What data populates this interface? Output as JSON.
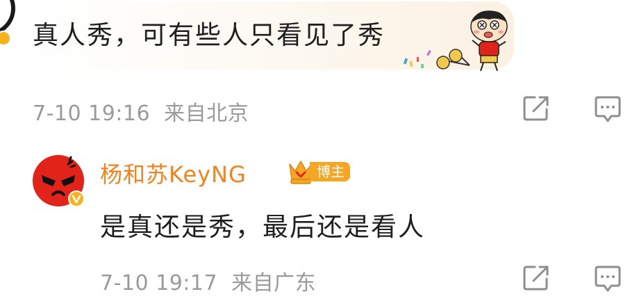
{
  "comment": {
    "text": "真人秀，可有些人只看见了秀",
    "date": "7-10 19:16",
    "location": "来自北京",
    "sticker_icon": "crayon-shin-chan-sticker-icon"
  },
  "reply": {
    "username": "杨和苏KeyNG",
    "badge_label": "博主",
    "badge_icon": "crown-icon",
    "avatar_icon": "angry-face-avatar-icon",
    "verified_icon": "verified-v-icon",
    "text": "是真还是秀，最后还是看人",
    "date": "7-10 19:17",
    "location": "来自广东"
  },
  "actions": {
    "share_icon": "share-icon",
    "comment_icon": "comment-icon"
  },
  "colors": {
    "username": "#f2831c",
    "meta_text": "#9a9a9a",
    "body_text": "#1f1f1f",
    "badge_bg": "#f5a623",
    "avatar_red": "#e2231a"
  }
}
